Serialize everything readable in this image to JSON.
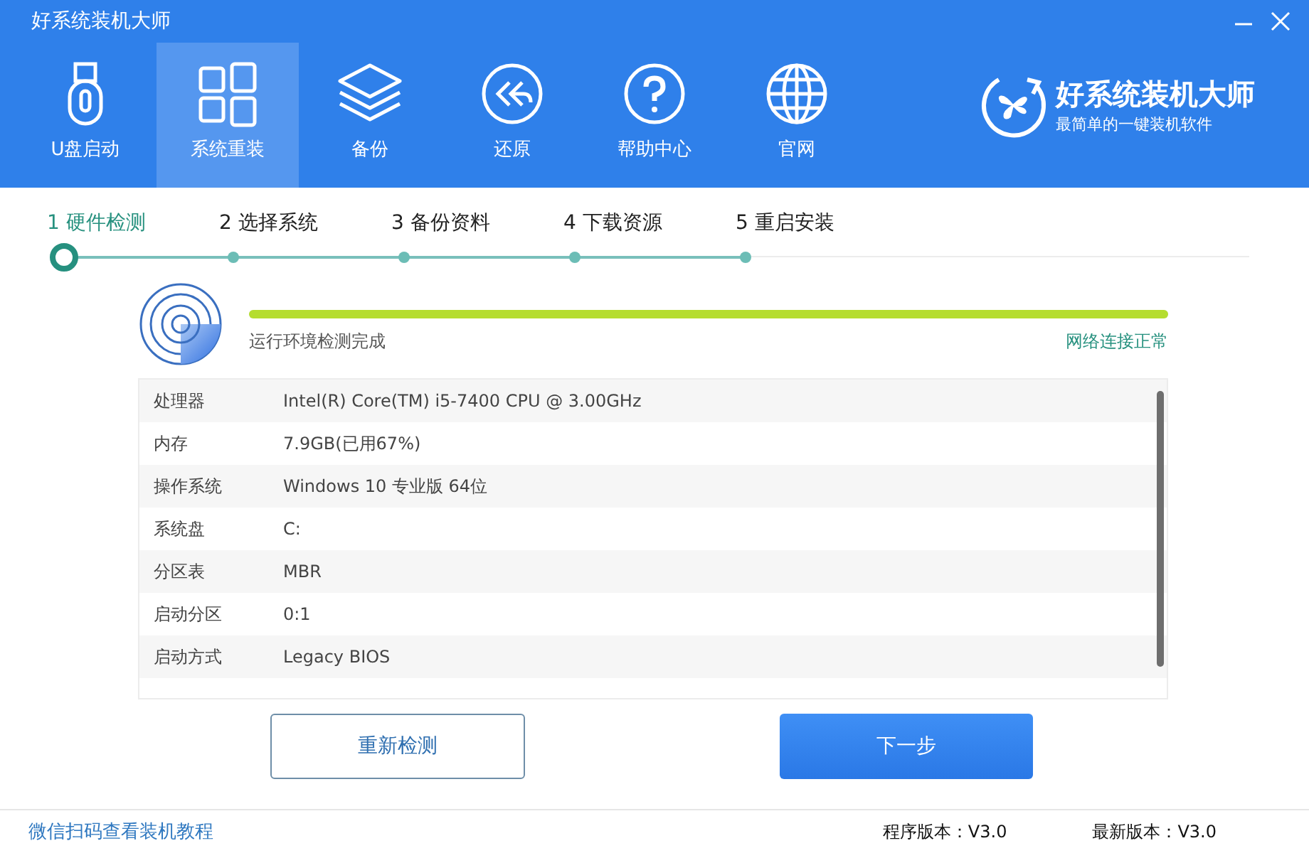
{
  "window": {
    "title": "好系统装机大师"
  },
  "nav": [
    {
      "label": "U盘启动",
      "selected": false
    },
    {
      "label": "系统重装",
      "selected": true
    },
    {
      "label": "备份",
      "selected": false
    },
    {
      "label": "还原",
      "selected": false
    },
    {
      "label": "帮助中心",
      "selected": false
    },
    {
      "label": "官网",
      "selected": false
    }
  ],
  "brand": {
    "name": "好系统装机大师",
    "tagline": "最简单的一键装机软件"
  },
  "steps": [
    {
      "number": "1",
      "label": "硬件检测",
      "selected": true
    },
    {
      "number": "2",
      "label": "选择系统",
      "selected": false
    },
    {
      "number": "3",
      "label": "备份资料",
      "selected": false
    },
    {
      "number": "4",
      "label": "下载资源",
      "selected": false
    },
    {
      "number": "5",
      "label": "重启安装",
      "selected": false
    }
  ],
  "check": {
    "level": 1,
    "status": "运行环境检测完成",
    "network": "网络连接正常"
  },
  "info_rows": [
    {
      "label": "处理器",
      "value": "Intel(R) Core(TM) i5-7400 CPU @ 3.00GHz"
    },
    {
      "label": "内存",
      "value": "7.9GB(已用67%)"
    },
    {
      "label": "操作系统",
      "value": "Windows 10 专业版 64位"
    },
    {
      "label": "系统盘",
      "value": "C:"
    },
    {
      "label": "分区表",
      "value": "MBR"
    },
    {
      "label": "启动分区",
      "value": "0:1"
    },
    {
      "label": "启动方式",
      "value": "Legacy BIOS"
    }
  ],
  "buttons": {
    "recheck": "重新检测",
    "next": "下一步"
  },
  "footer": {
    "link": "微信扫码查看装机教程",
    "program_version": "程序版本：V3.0",
    "latest_version": "最新版本：V3.0"
  }
}
